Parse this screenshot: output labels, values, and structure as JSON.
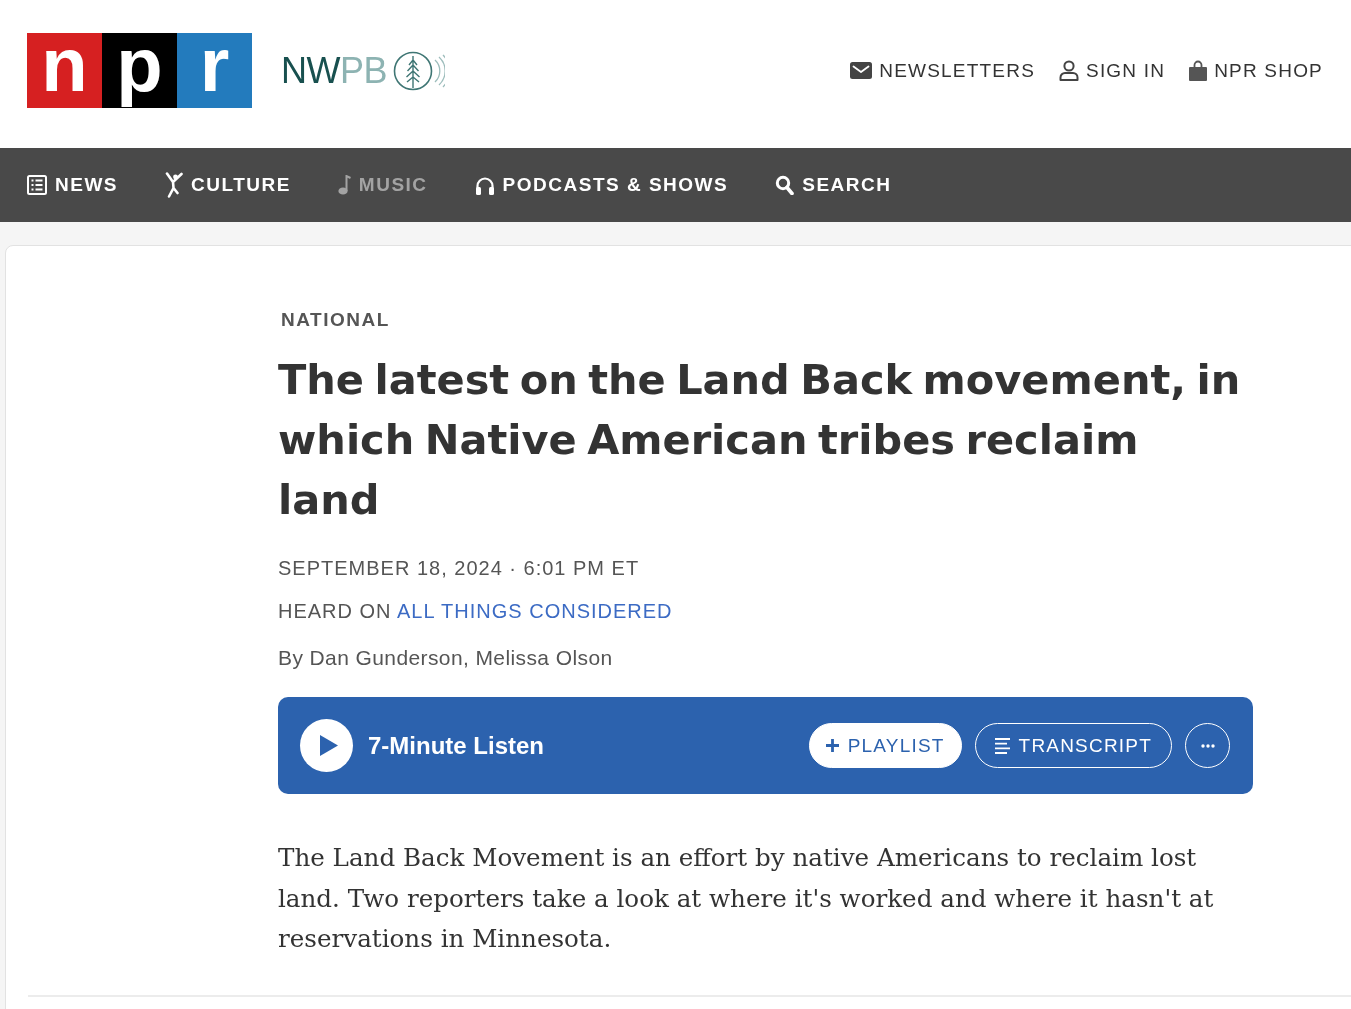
{
  "header": {
    "npr_logo": [
      {
        "letter": "n",
        "color": "#d62021"
      },
      {
        "letter": "p",
        "color": "#000000"
      },
      {
        "letter": "r",
        "color": "#237bbd"
      }
    ],
    "station_logo": {
      "dark": "NW",
      "light": "PB"
    },
    "links": [
      {
        "kind": "newsletters",
        "label": "NEWSLETTERS"
      },
      {
        "kind": "account",
        "label": "SIGN IN"
      },
      {
        "kind": "shop",
        "label": "NPR SHOP"
      }
    ]
  },
  "nav": [
    {
      "kind": "news",
      "label": "NEWS",
      "selected": false
    },
    {
      "kind": "culture",
      "label": "CULTURE",
      "selected": false
    },
    {
      "kind": "music",
      "label": "MUSIC",
      "selected": true
    },
    {
      "kind": "podcasts",
      "label": "PODCASTS & SHOWS",
      "selected": false
    },
    {
      "kind": "search",
      "label": "SEARCH",
      "selected": false
    }
  ],
  "article": {
    "section": "NATIONAL",
    "title": "The latest on the Land Back movement, in which Native American tribes reclaim land",
    "dateline": "SEPTEMBER 18, 2024 · 6:01 PM ET",
    "heard_on": {
      "prefix": "HEARD ON",
      "show": "ALL THINGS CONSIDERED"
    },
    "byline": "By Dan Gunderson, Melissa Olson",
    "player": {
      "label": "7-Minute Listen",
      "buttons": [
        {
          "kind": "playlist",
          "label": "PLAYLIST"
        },
        {
          "kind": "transcript",
          "label": "TRANSCRIPT"
        },
        {
          "kind": "more"
        }
      ]
    },
    "teaser": "The Land Back Movement is an effort by native Americans to reclaim lost land. Two reporters take a look at where it's worked and where it hasn't at reservations in Minnesota."
  }
}
